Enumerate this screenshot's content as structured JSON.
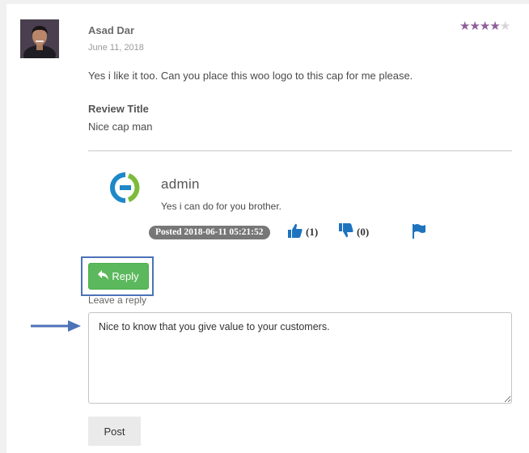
{
  "review": {
    "author": "Asad Dar",
    "date": "June 11, 2018",
    "rating": 4,
    "rating_max": 5,
    "text": "Yes i like it too. Can you place this woo logo to this cap for me please.",
    "title_label": "Review Title",
    "title_value": "Nice cap man"
  },
  "admin_reply": {
    "author": "admin",
    "text": "Yes i can do for you brother.",
    "posted": "Posted 2018-06-11 05:21:52",
    "likes": "(1)",
    "dislikes": "(0)"
  },
  "reply_form": {
    "button_label": "Reply",
    "leave_reply_label": "Leave a reply",
    "textarea_value": "Nice to know that you give value to your customers.",
    "post_label": "Post"
  },
  "colors": {
    "star_on": "#8e5f98",
    "reply_button": "#5cb85c",
    "icon_blue": "#1e73be",
    "highlight_outline": "#4c72b8"
  }
}
